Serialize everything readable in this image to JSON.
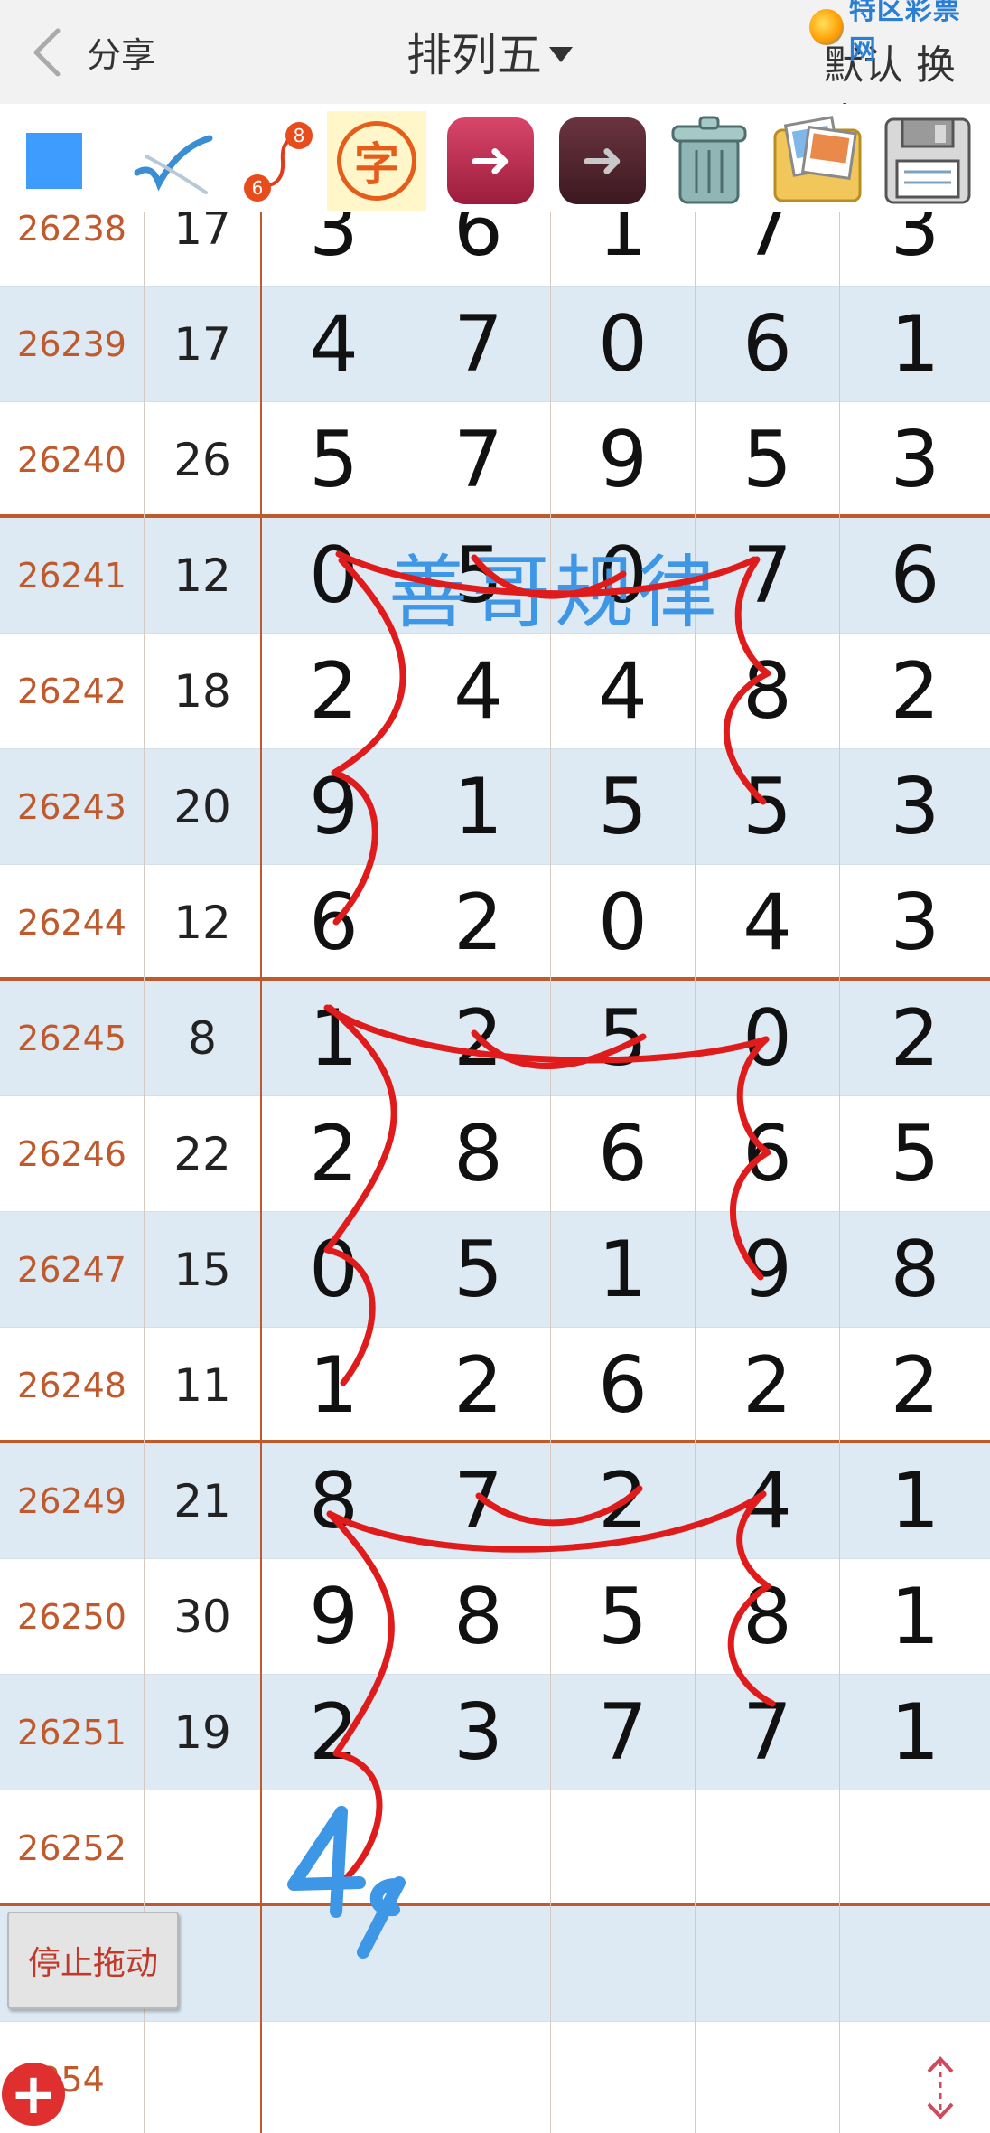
{
  "header": {
    "share_label": "分享",
    "title": "排列五",
    "brand": "特区彩票网",
    "skin_label": "默认 换皮"
  },
  "toolbar": {
    "color_swatch": "#3f9cff",
    "zi_label": "字",
    "link_badges": [
      "8",
      "6"
    ],
    "icons": [
      "square-color-icon",
      "pen-check-icon",
      "link-number-icon",
      "zi-icon",
      "back-arrow-icon",
      "forward-arrow-icon",
      "trash-can-icon",
      "photo-folder-icon",
      "floppy-disk-icon"
    ]
  },
  "watermark": "善哥规律",
  "rows": [
    {
      "issue": "26238",
      "sum": "17",
      "digits": [
        "3",
        "6",
        "1",
        "7",
        "3"
      ]
    },
    {
      "issue": "26239",
      "sum": "17",
      "digits": [
        "4",
        "7",
        "0",
        "6",
        "1"
      ]
    },
    {
      "issue": "26240",
      "sum": "26",
      "digits": [
        "5",
        "7",
        "9",
        "5",
        "3"
      ]
    },
    {
      "issue": "26241",
      "sum": "12",
      "digits": [
        "0",
        "5",
        "0",
        "7",
        "6"
      ]
    },
    {
      "issue": "26242",
      "sum": "18",
      "digits": [
        "2",
        "4",
        "4",
        "8",
        "2"
      ]
    },
    {
      "issue": "26243",
      "sum": "20",
      "digits": [
        "9",
        "1",
        "5",
        "5",
        "3"
      ]
    },
    {
      "issue": "26244",
      "sum": "12",
      "digits": [
        "6",
        "2",
        "0",
        "4",
        "3"
      ]
    },
    {
      "issue": "26245",
      "sum": "8",
      "digits": [
        "1",
        "2",
        "5",
        "0",
        "2"
      ]
    },
    {
      "issue": "26246",
      "sum": "22",
      "digits": [
        "2",
        "8",
        "6",
        "6",
        "5"
      ]
    },
    {
      "issue": "26247",
      "sum": "15",
      "digits": [
        "0",
        "5",
        "1",
        "9",
        "8"
      ]
    },
    {
      "issue": "26248",
      "sum": "11",
      "digits": [
        "1",
        "2",
        "6",
        "2",
        "2"
      ]
    },
    {
      "issue": "26249",
      "sum": "21",
      "digits": [
        "8",
        "7",
        "2",
        "4",
        "1"
      ]
    },
    {
      "issue": "26250",
      "sum": "30",
      "digits": [
        "9",
        "8",
        "5",
        "8",
        "1"
      ]
    },
    {
      "issue": "26251",
      "sum": "19",
      "digits": [
        "2",
        "3",
        "7",
        "7",
        "1"
      ]
    },
    {
      "issue": "26252",
      "sum": "",
      "digits": [
        "",
        "",
        "",
        "",
        ""
      ]
    },
    {
      "issue": "",
      "sum": "",
      "digits": [
        "",
        "",
        "",
        "",
        ""
      ]
    },
    {
      "issue": "254",
      "sum": "",
      "digits": [
        "",
        "",
        "",
        "",
        ""
      ]
    }
  ],
  "handwritten_note": "49",
  "stop_drag_label": "停止拖动",
  "colors": {
    "issue_text": "#c0592c",
    "row_shade": "#dde9f3",
    "group_divider": "#c0592c",
    "annotation_red": "#e01b1b",
    "annotation_blue": "#3d96e6"
  }
}
